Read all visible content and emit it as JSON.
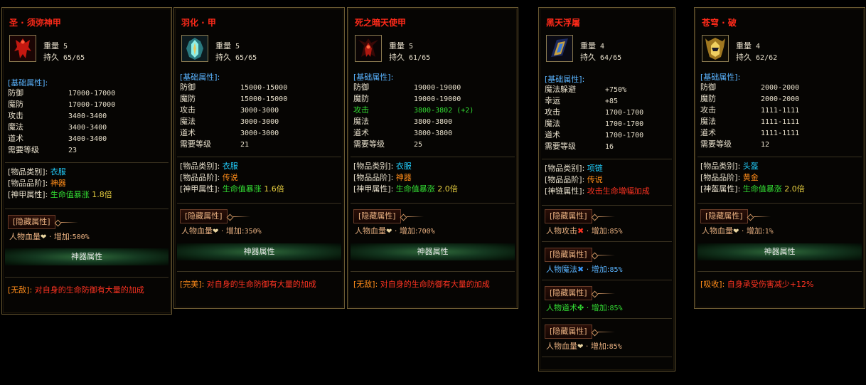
{
  "cards": [
    {
      "title": "圣 · 须弥神甲",
      "weight_label": "重量",
      "weight": "5",
      "dur_label": "持久",
      "dur": "65/65",
      "base_title": "[基础属性]:",
      "stats": [
        {
          "n": "防御",
          "v": "17000-17000"
        },
        {
          "n": "魔防",
          "v": "17000-17000"
        },
        {
          "n": "攻击",
          "v": "3400-3400"
        },
        {
          "n": "魔法",
          "v": "3400-3400"
        },
        {
          "n": "道术",
          "v": "3400-3400"
        },
        {
          "n": "需要等级",
          "v": "23"
        }
      ],
      "props": [
        {
          "k": "[物品类别]:",
          "v": "衣服"
        },
        {
          "k": "[物品品阶]:",
          "v": "神器"
        },
        {
          "k": "[神甲属性]:",
          "v": "生命值暴涨",
          "x": "1.8倍"
        }
      ],
      "hidden": [
        {
          "label": "[隐藏属性]",
          "attr": "人物血量",
          "inc": "增加:",
          "val": "500%"
        }
      ],
      "bar": "神器属性",
      "bottom_k": "[无敌]:",
      "bottom_t": "对自身的生命防御有大量的加成"
    },
    {
      "title": "羽化 · 甲",
      "weight_label": "重量",
      "weight": "5",
      "dur_label": "持久",
      "dur": "65/65",
      "base_title": "[基础属性]:",
      "stats": [
        {
          "n": "防御",
          "v": "15000-15000"
        },
        {
          "n": "魔防",
          "v": "15000-15000"
        },
        {
          "n": "攻击",
          "v": "3000-3000"
        },
        {
          "n": "魔法",
          "v": "3000-3000"
        },
        {
          "n": "道术",
          "v": "3000-3000"
        },
        {
          "n": "需要等级",
          "v": "21"
        }
      ],
      "props": [
        {
          "k": "[物品类别]:",
          "v": "衣服"
        },
        {
          "k": "[物品品阶]:",
          "v": "传说"
        },
        {
          "k": "[神甲属性]:",
          "v": "生命值暴涨",
          "x": "1.6倍"
        }
      ],
      "hidden": [
        {
          "label": "[隐藏属性]",
          "attr": "人物血量",
          "inc": "增加:",
          "val": "350%"
        }
      ],
      "bar": "神器属性",
      "bottom_k": "[完美]:",
      "bottom_t": "对自身的生命防御有大量的加成"
    },
    {
      "title": "死之暗天使甲",
      "weight_label": "重量",
      "weight": "5",
      "dur_label": "持久",
      "dur": "61/65",
      "base_title": "[基础属性]:",
      "stats": [
        {
          "n": "防御",
          "v": "19000-19000"
        },
        {
          "n": "魔防",
          "v": "19000-19000"
        },
        {
          "n": "攻击",
          "v": "3800-3802 (+2)",
          "green": true
        },
        {
          "n": "魔法",
          "v": "3800-3800"
        },
        {
          "n": "道术",
          "v": "3800-3800"
        },
        {
          "n": "需要等级",
          "v": "25"
        }
      ],
      "props": [
        {
          "k": "[物品类别]:",
          "v": "衣服"
        },
        {
          "k": "[物品品阶]:",
          "v": "神器"
        },
        {
          "k": "[神甲属性]:",
          "v": "生命值暴涨",
          "x": "2.0倍"
        }
      ],
      "hidden": [
        {
          "label": "[隐藏属性]",
          "attr": "人物血量",
          "inc": "增加:",
          "val": "700%"
        }
      ],
      "bar": "神器属性",
      "bottom_k": "[无敌]:",
      "bottom_t": "对自身的生命防御有大量的加成"
    },
    {
      "title": "黑天浮屠",
      "weight_label": "重量",
      "weight": "4",
      "dur_label": "持久",
      "dur": "64/65",
      "base_title": "[基础属性]:",
      "stats": [
        {
          "n": "魔法躲避",
          "v": "+750%"
        },
        {
          "n": "幸运",
          "v": "+85"
        },
        {
          "n": "攻击",
          "v": "1700-1700"
        },
        {
          "n": "魔法",
          "v": "1700-1700"
        },
        {
          "n": "道术",
          "v": "1700-1700"
        },
        {
          "n": "需要等级",
          "v": "16"
        }
      ],
      "props": [
        {
          "k": "[物品类别]:",
          "v": "项链"
        },
        {
          "k": "[物品品阶]:",
          "v": "传说"
        },
        {
          "k": "[神链属性]:",
          "v": "攻击生命增幅加成",
          "red": true
        }
      ],
      "hidden": [
        {
          "label": "[隐藏属性]",
          "attr": "人物攻击",
          "inc": "增加:",
          "val": "85%",
          "color": "#e8b080",
          "icon": "sword"
        },
        {
          "label": "[隐藏属性]",
          "attr": "人物魔法",
          "inc": "增加:",
          "val": "85%",
          "color": "#5ab4ff",
          "icon": "magic"
        },
        {
          "label": "[隐藏属性]",
          "attr": "人物道术",
          "inc": "增加:",
          "val": "85%",
          "color": "#33dd33",
          "icon": "tao"
        },
        {
          "label": "[隐藏属性]",
          "attr": "人物血量",
          "inc": "增加:",
          "val": "85%",
          "color": "#e8b080",
          "icon": "heart"
        }
      ]
    },
    {
      "title": "苍穹 · 破",
      "weight_label": "重量",
      "weight": "4",
      "dur_label": "持久",
      "dur": "62/62",
      "base_title": "[基础属性]:",
      "stats": [
        {
          "n": "防御",
          "v": "2000-2000"
        },
        {
          "n": "魔防",
          "v": "2000-2000"
        },
        {
          "n": "攻击",
          "v": "1111-1111"
        },
        {
          "n": "魔法",
          "v": "1111-1111"
        },
        {
          "n": "道术",
          "v": "1111-1111"
        },
        {
          "n": "需要等级",
          "v": "12"
        }
      ],
      "props": [
        {
          "k": "[物品类别]:",
          "v": "头盔"
        },
        {
          "k": "[物品品阶]:",
          "v": "黄金"
        },
        {
          "k": "[神盔属性]:",
          "v": "生命值暴涨",
          "x": "2.0倍"
        }
      ],
      "hidden": [
        {
          "label": "[隐藏属性]",
          "attr": "人物血量",
          "inc": "增加:",
          "val": "1%"
        }
      ],
      "bar": "神器属性",
      "bottom_k": "[吸收]:",
      "bottom_t": "自身承受伤害减少+12%"
    }
  ]
}
